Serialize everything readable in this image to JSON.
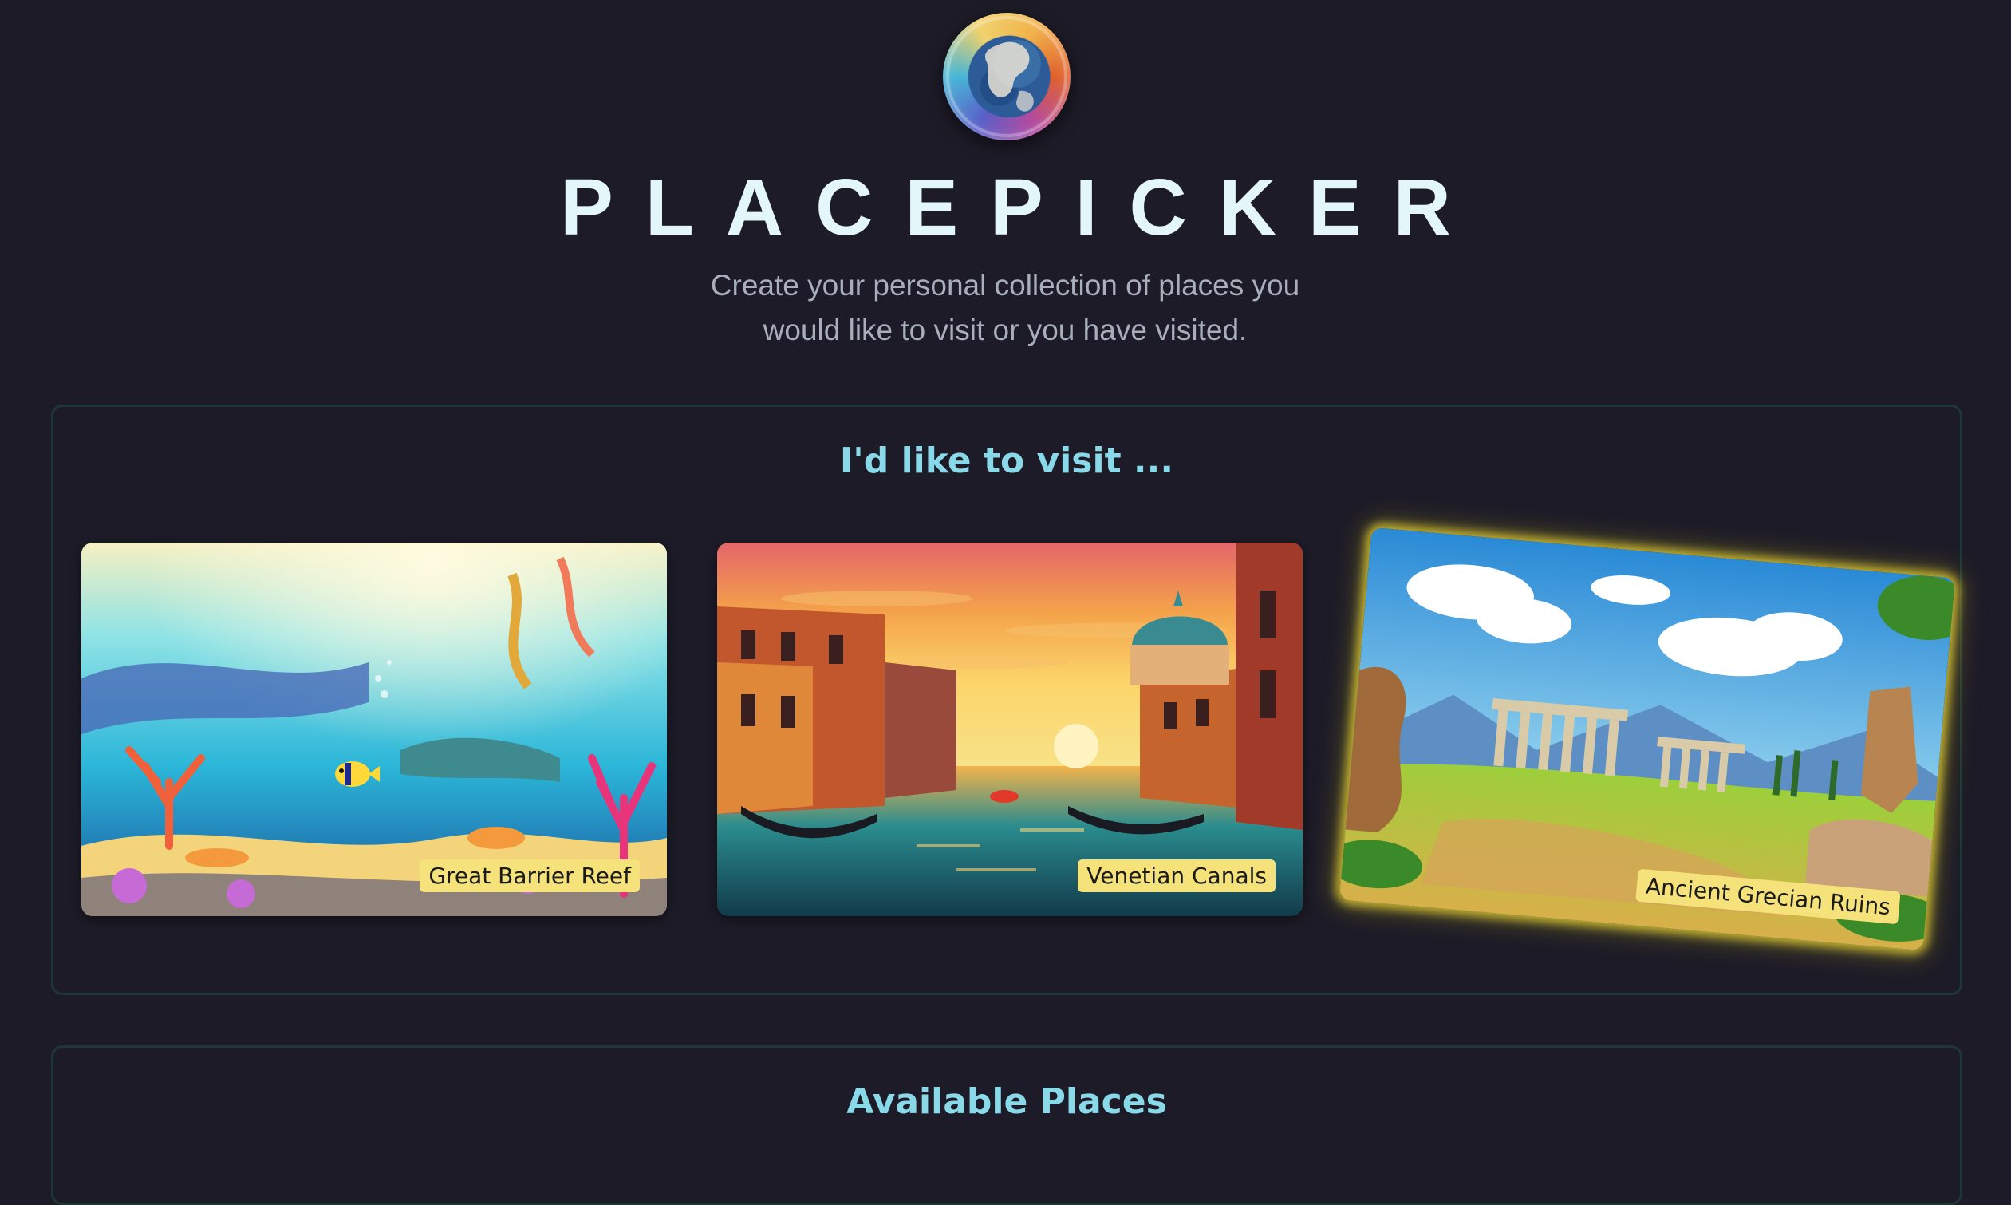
{
  "header": {
    "logo_icon": "globe-icon",
    "title": "PLACEPICKER",
    "tagline": "Create your personal collection of places you would like to visit or you have visited."
  },
  "visit_section": {
    "title": "I'd like to visit ...",
    "places": [
      {
        "name": "Great Barrier Reef"
      },
      {
        "name": "Venetian Canals"
      },
      {
        "name": "Ancient Grecian Ruins",
        "highlighted": true
      }
    ]
  },
  "available_section": {
    "title": "Available Places"
  },
  "colors": {
    "background": "#1c1b27",
    "title": "#e3f6fa",
    "section_heading": "#8ad9e8",
    "label_bg": "#f6e27a",
    "highlight_glow": "#e8d436"
  }
}
